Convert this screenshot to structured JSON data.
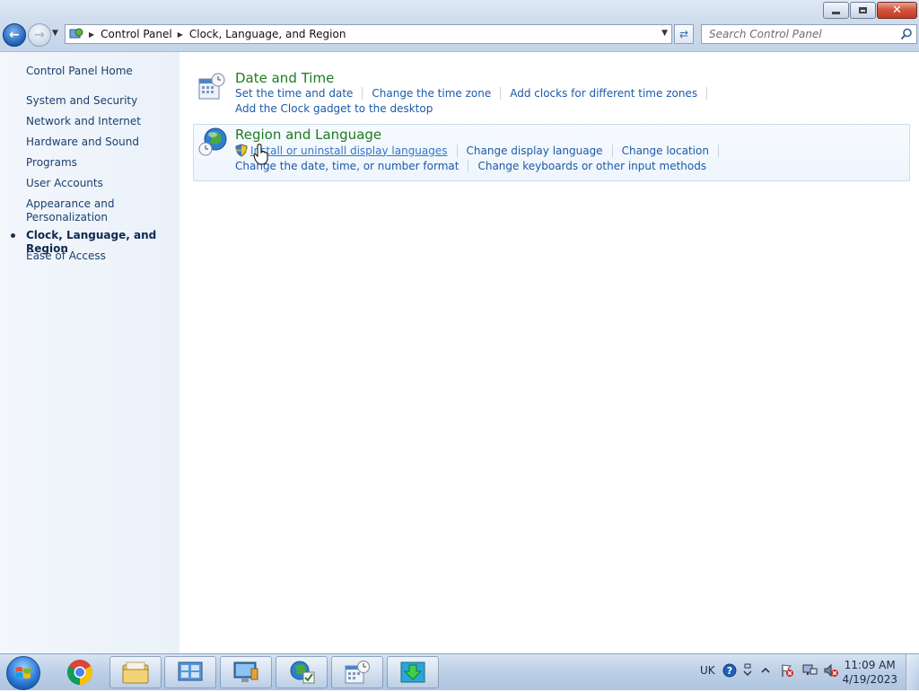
{
  "window": {
    "caption_buttons": {
      "minimize": "minimize",
      "restore": "restore",
      "close": "✕"
    }
  },
  "address": {
    "crumbs": [
      "Control Panel",
      "Clock, Language, and Region"
    ],
    "search_placeholder": "Search Control Panel"
  },
  "left_nav": {
    "home": "Control Panel Home",
    "items": [
      {
        "label": "System and Security"
      },
      {
        "label": "Network and Internet"
      },
      {
        "label": "Hardware and Sound"
      },
      {
        "label": "Programs"
      },
      {
        "label": "User Accounts"
      },
      {
        "label": "Appearance and Personalization"
      },
      {
        "label": "Clock, Language, and Region",
        "current": true
      },
      {
        "label": "Ease of Access"
      }
    ]
  },
  "categories": [
    {
      "title": "Date and Time",
      "icon": "calendar-clock-icon",
      "links": [
        [
          "Set the time and date",
          "Change the time zone",
          "Add clocks for different time zones"
        ],
        [
          "Add the Clock gadget to the desktop"
        ]
      ]
    },
    {
      "title": "Region and Language",
      "icon": "globe-clock-icon",
      "links": [
        [
          "Install or uninstall display languages",
          "Change display language",
          "Change location"
        ],
        [
          "Change the date, time, or number format",
          "Change keyboards or other input methods"
        ]
      ]
    }
  ],
  "taskbar": {
    "apps": [
      "start-orb",
      "chrome-icon",
      "explorer-icon",
      "control-panel-icon",
      "remote-desktop-icon",
      "region-language-icon",
      "date-time-icon",
      "download-icon"
    ],
    "tray_language": "UK",
    "clock_time": "11:09 AM",
    "clock_date": "4/19/2023"
  },
  "colors": {
    "link": "#1c5aa8",
    "category_title": "#1e7b1e",
    "nav_text": "#1b3f6e"
  }
}
